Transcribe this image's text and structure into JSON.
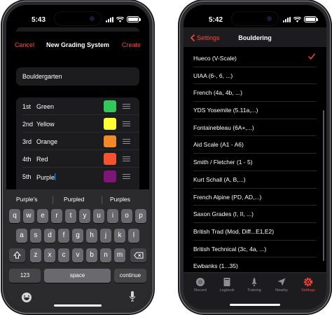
{
  "colors": {
    "accent": "#ff453a",
    "green": "#34c759",
    "yellow": "#ffff33",
    "orange": "#f0892c",
    "red": "#f4532f",
    "purple": "#7e1577"
  },
  "left": {
    "status_time": "5:43",
    "nav": {
      "cancel": "Cancel",
      "title": "New Grading System",
      "create": "Create"
    },
    "name_value": "Bouldergarten",
    "grades": [
      {
        "rank": "1st",
        "name": "Green",
        "color": "#34c759"
      },
      {
        "rank": "2nd",
        "name": "Yellow",
        "color": "#ffff33"
      },
      {
        "rank": "3rd",
        "name": "Orange",
        "color": "#f0892c"
      },
      {
        "rank": "4th",
        "name": "Red",
        "color": "#f4532f"
      },
      {
        "rank": "5th",
        "name": "Purple",
        "color": "#7e1577"
      }
    ],
    "keyboard": {
      "suggestions": [
        "Purple's",
        "Purpled",
        "Purples"
      ],
      "row1": [
        "q",
        "w",
        "e",
        "r",
        "t",
        "y",
        "u",
        "i",
        "o",
        "p"
      ],
      "row2": [
        "a",
        "s",
        "d",
        "f",
        "g",
        "h",
        "j",
        "k",
        "l"
      ],
      "row3": [
        "z",
        "x",
        "c",
        "v",
        "b",
        "n",
        "m"
      ],
      "numbers_key": "123",
      "space_key": "space",
      "return_key": "continue",
      "shift_icon": "shift-icon",
      "delete_icon": "delete-icon",
      "emoji_icon": "emoji-icon",
      "mic_icon": "mic-icon"
    }
  },
  "right": {
    "status_time": "5:42",
    "nav": {
      "back": "Settings",
      "title": "Bouldering"
    },
    "options": [
      {
        "label": "Hueco (V-Scale)",
        "selected": true
      },
      {
        "label": "UIAA (6-, 6, ...)",
        "selected": false
      },
      {
        "label": "French (4a, 4b, ...)",
        "selected": false
      },
      {
        "label": "YDS Yosemite (5.11a,...)",
        "selected": false
      },
      {
        "label": "Fontainebleau (6A+,...)",
        "selected": false
      },
      {
        "label": "Aid Scale (A1 - A6)",
        "selected": false
      },
      {
        "label": "Smith / Fletcher (1 - 5)",
        "selected": false
      },
      {
        "label": "Kurt Schall (A, B,...)",
        "selected": false
      },
      {
        "label": "French Alpine (PD, AD,...)",
        "selected": false
      },
      {
        "label": "Saxon Grades (I, II, ...)",
        "selected": false
      },
      {
        "label": "British Trad (Mod, Diff...E1,E2)",
        "selected": false
      },
      {
        "label": "British Technical (3c, 4a, ...)",
        "selected": false
      },
      {
        "label": "Ewbanks (1...35)",
        "selected": false
      }
    ],
    "tabs": [
      {
        "label": "Record",
        "icon": "record-icon",
        "active": false
      },
      {
        "label": "Logbook",
        "icon": "book-icon",
        "active": false
      },
      {
        "label": "Training",
        "icon": "rocket-icon",
        "active": false
      },
      {
        "label": "Nearby",
        "icon": "location-arrow-icon",
        "active": false
      },
      {
        "label": "Settings",
        "icon": "gear-icon",
        "active": true
      }
    ]
  }
}
